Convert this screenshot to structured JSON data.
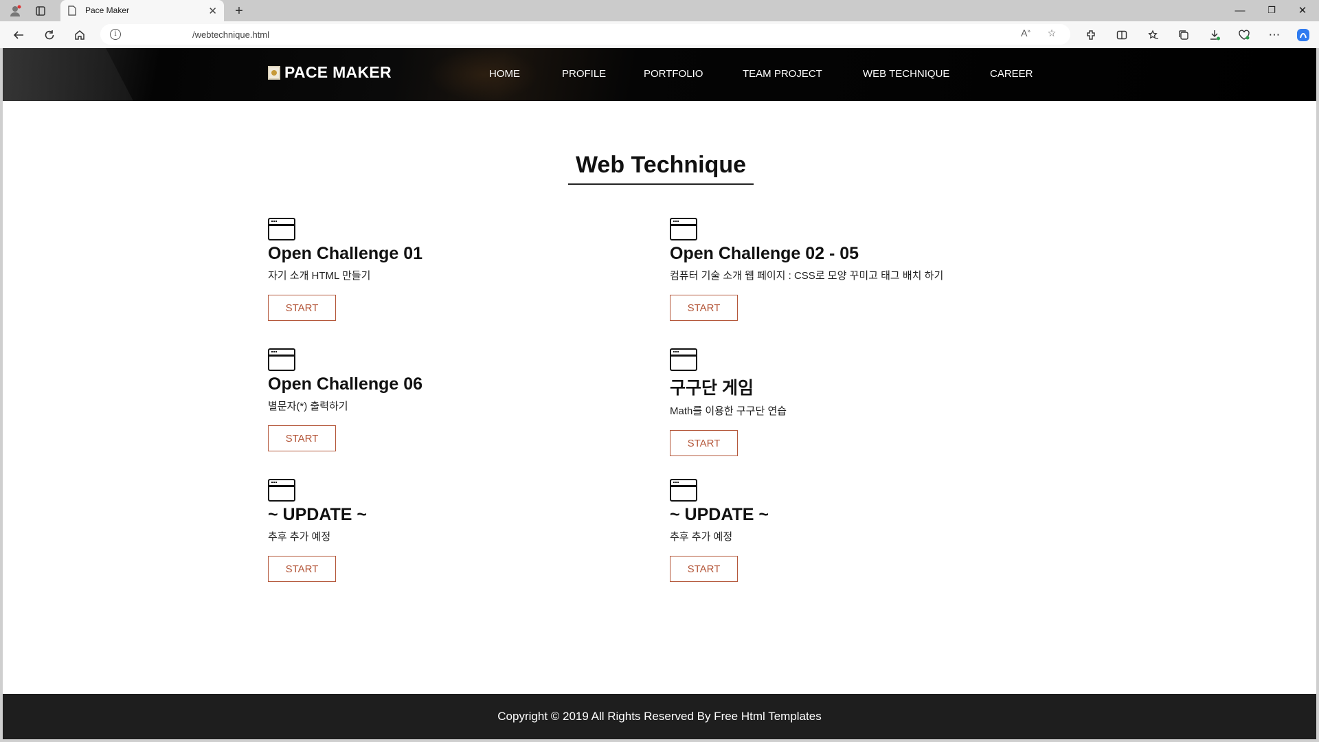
{
  "browser": {
    "tab_title": "Pace Maker",
    "tab_close": "✕",
    "new_tab": "+",
    "url": "/webtechnique.html",
    "window_controls": {
      "minimize": "—",
      "restore": "❐",
      "close": "✕"
    }
  },
  "site": {
    "logo_text": "PACE MAKER",
    "nav": [
      "HOME",
      "PROFILE",
      "PORTFOLIO",
      "TEAM PROJECT",
      "WEB TECHNIQUE",
      "CAREER"
    ],
    "page_title": "Web Technique",
    "cards": [
      {
        "title": "Open Challenge 01",
        "desc": "자기 소개 HTML 만들기",
        "button": "START"
      },
      {
        "title": "Open Challenge 02 - 05",
        "desc": "컴퓨터 기술 소개 웹 페이지 : CSS로 모양 꾸미고 태그 배치 하기",
        "button": "START"
      },
      {
        "title": "Open Challenge 06",
        "desc": "별문자(*) 출력하기",
        "button": "START"
      },
      {
        "title": "구구단 게임",
        "desc": "Math를 이용한 구구단 연습",
        "button": "START"
      },
      {
        "title": "~ UPDATE ~",
        "desc": "추후 추가 예정",
        "button": "START"
      },
      {
        "title": "~ UPDATE ~",
        "desc": "추후 추가 예정",
        "button": "START"
      }
    ],
    "footer": "Copyright © 2019 All Rights Reserved By Free Html Templates"
  },
  "colors": {
    "button_accent": "#b4573a",
    "header_bg": "#000000",
    "footer_bg": "#1e1e1e"
  }
}
